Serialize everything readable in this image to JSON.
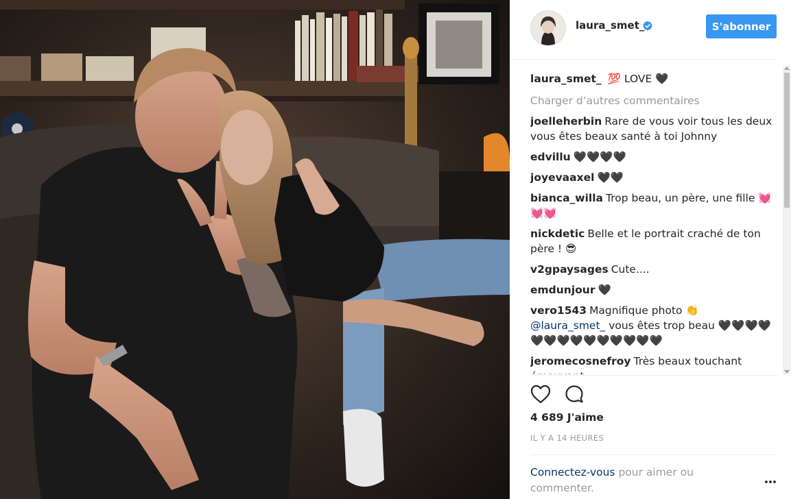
{
  "post": {
    "photo_alt": "",
    "header": {
      "username": "laura_smet_",
      "verified_icon": "verified-badge-icon",
      "follow_label": "S'abonner"
    },
    "caption": {
      "user": "laura_smet_",
      "text": "💯 LOVE 🖤"
    },
    "load_more_label": "Charger d’autres commentaires",
    "comments": [
      {
        "user": "joelleherbin",
        "text": "Rare de vous voir tous les deux vous êtes beaux santé à toi Johnny"
      },
      {
        "user": "edvillu",
        "text": "🖤🖤🖤🖤"
      },
      {
        "user": "joyevaaxel",
        "text": "🖤🖤"
      },
      {
        "user": "bianca_willa",
        "text": "Trop beau, un père, une fille 💓💓💓"
      },
      {
        "user": "nickdetic",
        "text": "Belle et le portrait craché de ton père ! 😎"
      },
      {
        "user": "v2gpaysages",
        "text": "Cute...."
      },
      {
        "user": "emdunjour",
        "text": "🖤"
      },
      {
        "user": "vero1543",
        "text": "Magnifique photo 👏",
        "mention": "@laura_smet_",
        "text2": "vous êtes trop beau 🖤🖤🖤🖤 🖤🖤🖤🖤🖤🖤🖤🖤🖤🖤"
      },
      {
        "user": "jeromecosnefroy",
        "text": "Très beaux touchant émouvant"
      }
    ],
    "likes_label": "4 689 J'aime",
    "timestamp": "IL Y A 14 HEURES",
    "login_link": "Connectez-vous",
    "login_text": "pour aimer ou commenter."
  },
  "colors": {
    "follow_button": "#3897f0",
    "username": "#262626",
    "muted": "#999999",
    "link": "#003569",
    "verified": "#3897f0"
  }
}
